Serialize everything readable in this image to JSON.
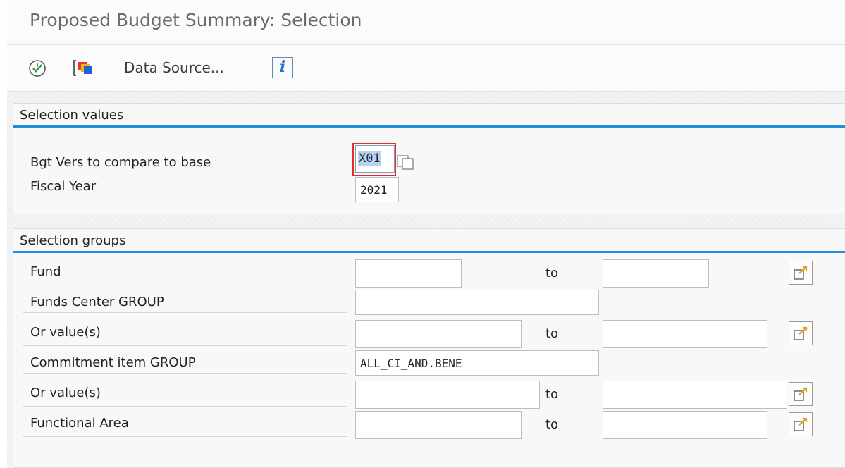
{
  "window": {
    "title": "Proposed Budget Summary: Selection"
  },
  "toolbar": {
    "execute_icon": "execute-clock-icon",
    "variant_icon": "get-variant-icon",
    "data_source_label": "Data Source...",
    "info_label": "i"
  },
  "selection_values": {
    "header": "Selection values",
    "rows": [
      {
        "label": "Bgt Vers to compare to base",
        "value": "X01"
      },
      {
        "label": "Fiscal Year",
        "value": "2021"
      }
    ]
  },
  "selection_groups": {
    "header": "Selection groups",
    "to_label": "to",
    "rows": [
      {
        "label": "Fund",
        "from": "",
        "to": ""
      },
      {
        "label": "Funds Center GROUP",
        "value": ""
      },
      {
        "label": "Or value(s)",
        "from": "",
        "to": ""
      },
      {
        "label": "Commitment item GROUP",
        "value": "ALL_CI_AND.BENE"
      },
      {
        "label": "Or value(s)",
        "from": "",
        "to": ""
      },
      {
        "label": "Functional Area",
        "from": "",
        "to": ""
      }
    ]
  },
  "colors": {
    "section_accent": "#1e8fd8",
    "focus_border": "#e22d2d",
    "selection_highlight": "#b9d3ee"
  }
}
